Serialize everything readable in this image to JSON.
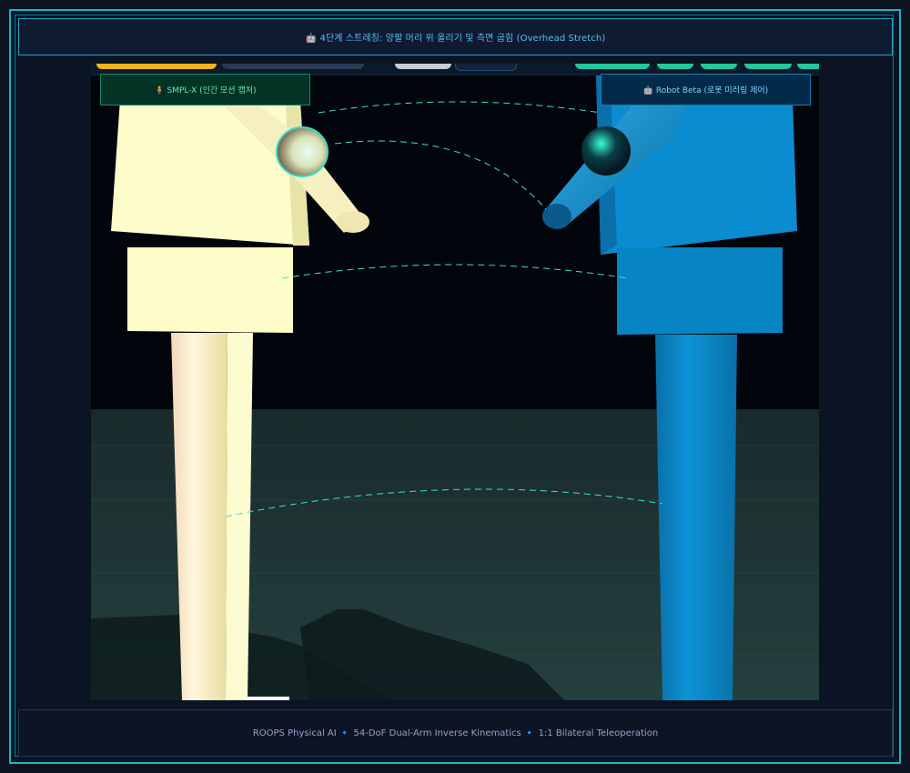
{
  "header": {
    "title": "🤖 4단계 스트레칭: 양팔 머리 위 올리기 및 측면 굽힘 (Overhead Stretch)"
  },
  "viewport": {
    "left_label": "🧍 SMPL-X (인간 모션 캡처)",
    "right_label": "🤖 Robot Beta (로봇 미러링 제어)",
    "toolbar_buttons": [
      {
        "name": "mode-button-active",
        "color": "#f5b31a"
      },
      {
        "name": "mode-button",
        "color": "#2a3a55"
      },
      {
        "name": "view-button",
        "color": "#c7ccd6"
      },
      {
        "name": "view-button-2",
        "color": "#13233b"
      },
      {
        "name": "status-chip-1",
        "color": "#21c7a0"
      },
      {
        "name": "status-chip-2",
        "color": "#21c7a0"
      },
      {
        "name": "status-chip-3",
        "color": "#21c7a0"
      },
      {
        "name": "status-chip-4",
        "color": "#21c7a0"
      }
    ],
    "colors": {
      "human_body": "#fdfccb",
      "robot_body": "#0a87c8",
      "link_line": "#39e0d0"
    }
  },
  "footer": {
    "text": "ROOPS Physical AI 🔹 54-DoF Dual-Arm Inverse Kinematics 🔹 1:1 Bilateral Teleoperation"
  }
}
